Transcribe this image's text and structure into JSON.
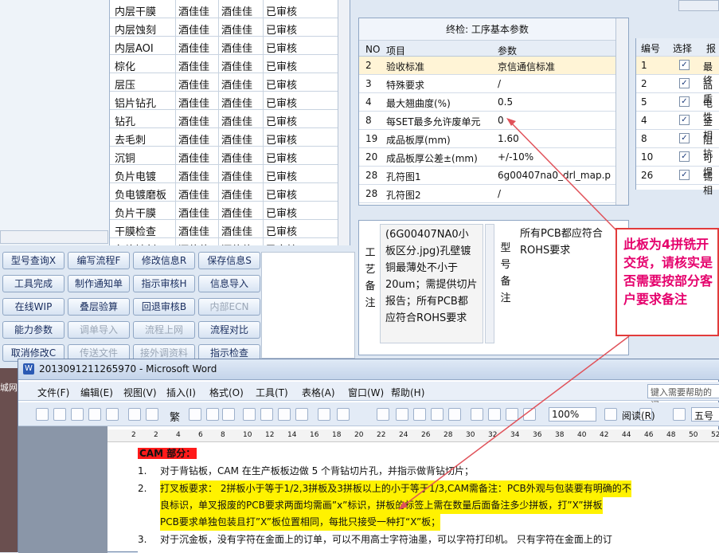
{
  "process_table": {
    "rows": [
      [
        "内层干膜",
        "酒佳佳",
        "酒佳佳",
        "已审核"
      ],
      [
        "内层蚀刻",
        "酒佳佳",
        "酒佳佳",
        "已审核"
      ],
      [
        "内层AOI",
        "酒佳佳",
        "酒佳佳",
        "已审核"
      ],
      [
        "棕化",
        "酒佳佳",
        "酒佳佳",
        "已审核"
      ],
      [
        "层压",
        "酒佳佳",
        "酒佳佳",
        "已审核"
      ],
      [
        "铝片钻孔",
        "酒佳佳",
        "酒佳佳",
        "已审核"
      ],
      [
        "钻孔",
        "酒佳佳",
        "酒佳佳",
        "已审核"
      ],
      [
        "去毛刺",
        "酒佳佳",
        "酒佳佳",
        "已审核"
      ],
      [
        "沉铜",
        "酒佳佳",
        "酒佳佳",
        "已审核"
      ],
      [
        "负片电镀",
        "酒佳佳",
        "酒佳佳",
        "已审核"
      ],
      [
        "负电镀磨板",
        "酒佳佳",
        "酒佳佳",
        "已审核"
      ],
      [
        "负片干膜",
        "酒佳佳",
        "酒佳佳",
        "已审核"
      ],
      [
        "干膜检查",
        "酒佳佳",
        "酒佳佳",
        "已审核"
      ],
      [
        "负片蚀刻",
        "酒佳佳",
        "酒佳佳",
        "已审核"
      ]
    ]
  },
  "param_panel": {
    "title": "终检: 工序基本参数",
    "headers": [
      "NO",
      "项目",
      "参数"
    ],
    "rows": [
      [
        "2",
        "验收标准",
        "京信通信标准"
      ],
      [
        "3",
        "特殊要求",
        "/"
      ],
      [
        "4",
        "最大翘曲度(%)",
        "0.5"
      ],
      [
        "8",
        "每SET最多允许废单元",
        "0"
      ],
      [
        "19",
        "成品板厚(mm)",
        "1.60"
      ],
      [
        "20",
        "成品板厚公差±(mm)",
        "+/-10%"
      ],
      [
        "28",
        "孔符图1",
        "6g00407na0_drl_map.p"
      ],
      [
        "28",
        "孔符图2",
        "/"
      ]
    ]
  },
  "remarks": {
    "process_label": "工艺备注",
    "process_text": "(6G00407NA0小板区分.jpg)孔壁镀铜最薄处不小于20um；需提供切片报告；所有PCB都应符合ROHS要求",
    "model_label": "型号备注",
    "model_text": "所有PCB都应符合ROHS要求"
  },
  "right_table": {
    "headers": [
      "编号",
      "选择",
      "报告"
    ],
    "rows": [
      [
        "1",
        "最终"
      ],
      [
        "2",
        "品质"
      ],
      [
        "5",
        "电性"
      ],
      [
        "4",
        "金相"
      ],
      [
        "8",
        "阻抗"
      ],
      [
        "10",
        "可焊"
      ],
      [
        "26",
        "锡相"
      ]
    ]
  },
  "buttons": [
    {
      "label": "型号查询X",
      "disabled": false
    },
    {
      "label": "编写流程F",
      "disabled": false
    },
    {
      "label": "修改信息R",
      "disabled": false
    },
    {
      "label": "保存信息S",
      "disabled": false
    },
    {
      "label": "工具完成",
      "disabled": false
    },
    {
      "label": "制作通知单",
      "disabled": false
    },
    {
      "label": "指示审核H",
      "disabled": false
    },
    {
      "label": "信息导入",
      "disabled": false
    },
    {
      "label": "在线WIP",
      "disabled": false
    },
    {
      "label": "叠层验算",
      "disabled": false
    },
    {
      "label": "回退审核B",
      "disabled": false
    },
    {
      "label": "内部ECN",
      "disabled": true
    },
    {
      "label": "能力参数",
      "disabled": false
    },
    {
      "label": "调单导入",
      "disabled": true
    },
    {
      "label": "流程上网",
      "disabled": true
    },
    {
      "label": "流程对比",
      "disabled": false
    },
    {
      "label": "取消修改C",
      "disabled": false
    },
    {
      "label": "传送文件",
      "disabled": true
    },
    {
      "label": "接外调资料",
      "disabled": true
    },
    {
      "label": "指示检查",
      "disabled": false
    }
  ],
  "annotation": {
    "text": "此板为4拼铣开交货，请核实是否需要按部分客户要求备注",
    "color": "#e5006c",
    "border_color": "#e23b3b"
  },
  "word": {
    "title": "2013091211265970 - Microsoft Word",
    "menu": [
      "文件(F)",
      "编辑(E)",
      "视图(V)",
      "插入(I)",
      "格式(O)",
      "工具(T)",
      "表格(A)",
      "窗口(W)",
      "帮助(H)"
    ],
    "help_placeholder": "键入需要帮助的问",
    "zoom": "100%",
    "read_label": "阅读(R)",
    "style_label": "繁",
    "font_size": "五号",
    "ruler_marks": [
      "2",
      "2",
      "4",
      "6",
      "8",
      "10",
      "12",
      "14",
      "16",
      "18",
      "20",
      "22",
      "24",
      "26",
      "28",
      "30",
      "32",
      "34",
      "36",
      "38",
      "40",
      "42",
      "44",
      "46",
      "48",
      "50",
      "52"
    ],
    "heading": "CAM 部分：",
    "items": [
      {
        "num": "1.",
        "text": "对于背钻板，CAM 在生产板板边做 5 个背钻切片孔，并指示做背钻切片；"
      },
      {
        "num": "2.",
        "text_a": "打叉板要求： 2拼板小于等于1/2,3拼板及3拼板以上的小于等于1/3,CAM需备注：PCB外观与包装要有明确的不",
        "text_b": "良标识，单叉报废的PCB要求两面均需画”x”标识，拼板的标签上需在数量后面备注多少拼板，打”X”拼板",
        "text_c": "PCB要求单独包装且打”X”板位置相同，每批只接受一种打“X”板；"
      },
      {
        "num": "3.",
        "text": "对于沉金板，没有字符在金面上的订单，可以不用高士字符油墨，可以字符打印机。 只有字符在金面上的订"
      }
    ]
  },
  "desktop_label": "城网"
}
